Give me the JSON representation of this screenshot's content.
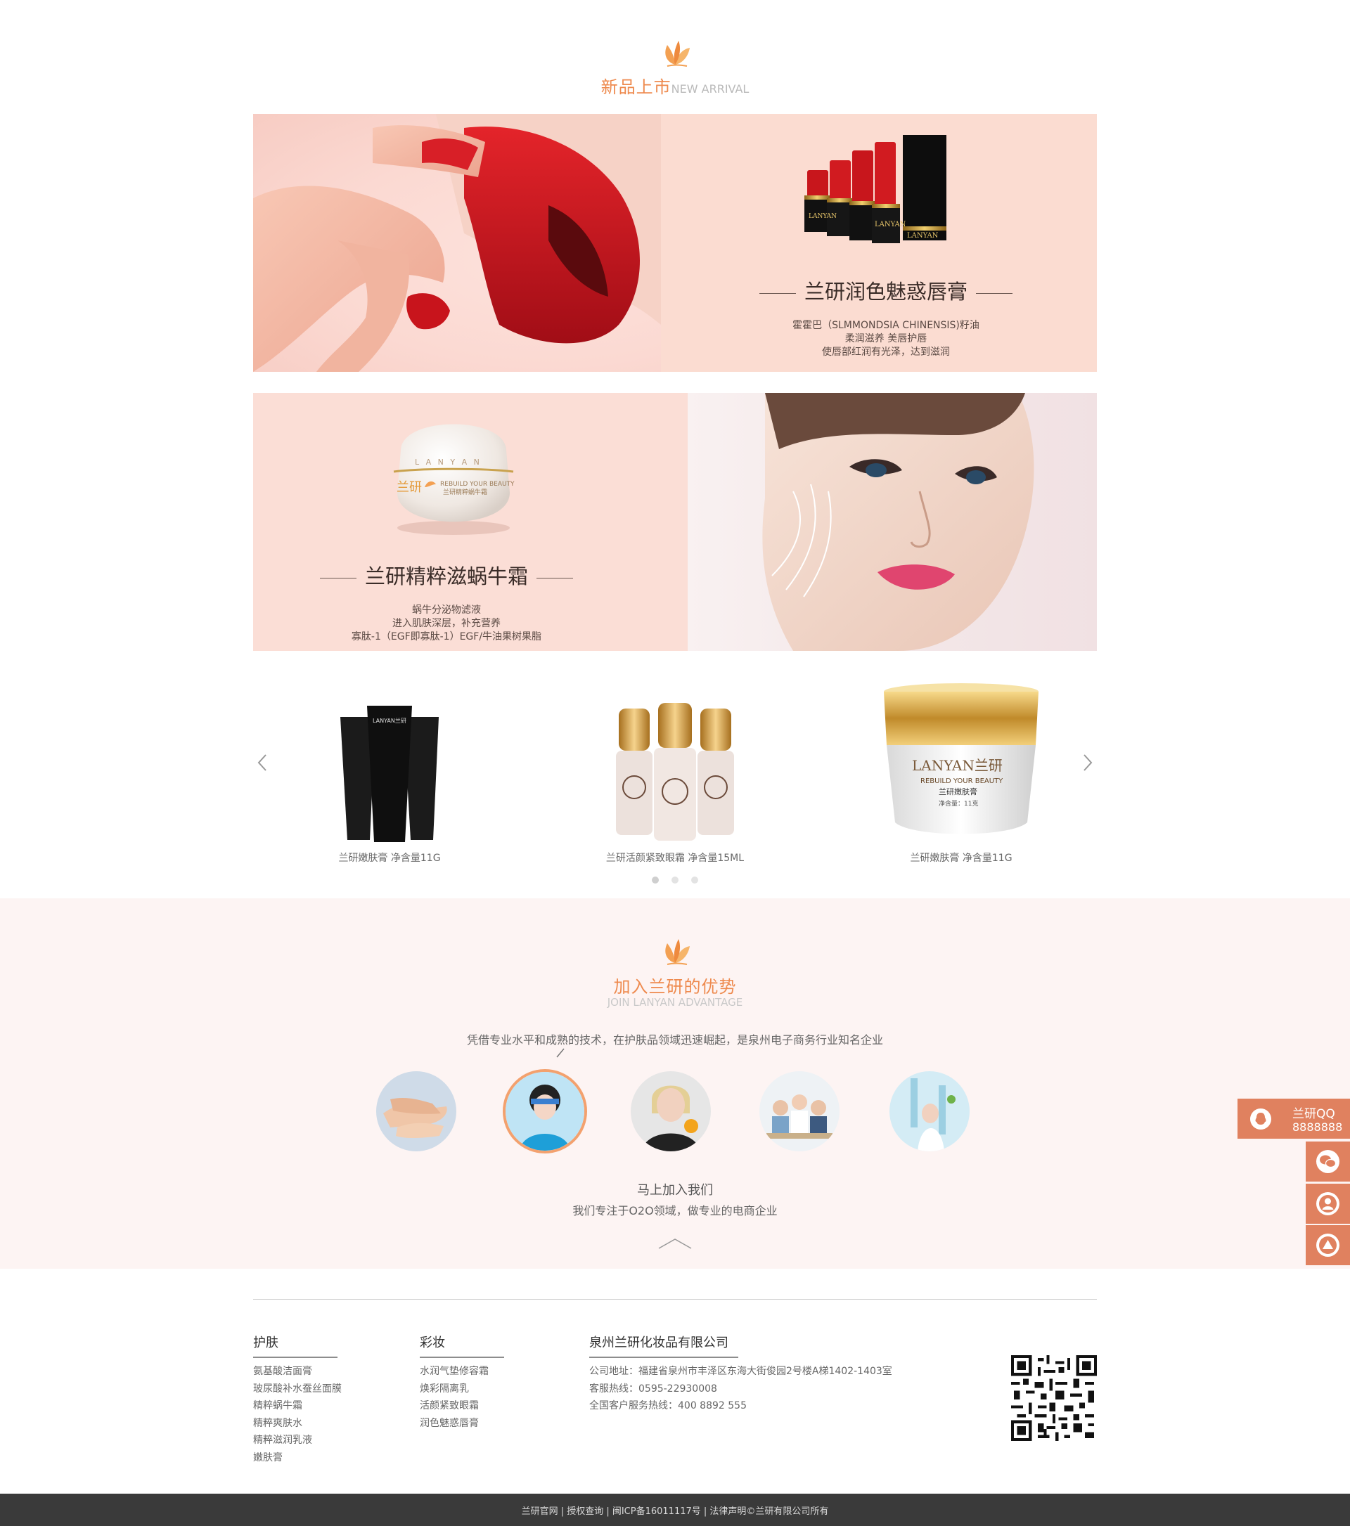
{
  "new_arrival": {
    "title": "新品上市",
    "title_en": "NEW ARRIVAL"
  },
  "banner_lipstick": {
    "name": "兰研润色魅惑唇膏",
    "desc": [
      "霍霍巴（SLMMONDSIA CHINENSIS)籽油",
      "柔润滋养 美唇护唇",
      "使唇部红润有光泽，达到滋润"
    ],
    "product_text": "LANYAN"
  },
  "banner_cream": {
    "name": "兰研精粹滋蜗牛霜",
    "desc": [
      "蜗牛分泌物滤液",
      "进入肌肤深层，补充营养",
      "寡肽-1（EGF即寡肽-1）EGF/牛油果树果脂"
    ],
    "jar_brand": "兰研",
    "jar_tagline": "REBUILD YOUR BEAUTY",
    "jar_name": "兰研精粹蜗牛霜",
    "jar_ring": "L A N Y A N"
  },
  "carousel": {
    "products": [
      {
        "caption": "兰研嫩肤膏  净含量11G"
      },
      {
        "caption": "兰研活颜紧致眼霜  净含量15ML"
      },
      {
        "caption": "兰研嫩肤膏  净含量11G"
      }
    ],
    "tube_label": "LANYAN兰研",
    "jar_label": "LANYAN兰研",
    "jar_tagline": "REBUILD YOUR BEAUTY",
    "jar_name": "兰研嫩肤膏",
    "jar_net": "净含量：11克",
    "active_dot": 0
  },
  "advantage": {
    "title": "加入兰研的优势",
    "title_en": "JOIN LANYAN ADVANTAGE",
    "intro": "凭借专业水平和成熟的技术，在护肤品领域迅速崛起，是泉州电子商务行业知名企业",
    "join_title": "马上加入我们",
    "join_desc": "我们专注于O2O领域，做专业的电商企业",
    "active_circle": 1
  },
  "footer": {
    "skin": {
      "title": "护肤",
      "items": [
        "氨基酸洁面膏",
        "玻尿酸补水蚕丝面膜",
        "精粹蜗牛霜",
        "精粹爽肤水",
        "精粹滋润乳液",
        "嫩肤膏"
      ]
    },
    "makeup": {
      "title": "彩妆",
      "items": [
        "水润气垫修容霜",
        "焕彩隔离乳",
        "活颜紧致眼霜",
        "润色魅惑唇膏"
      ]
    },
    "company": {
      "title": "泉州兰研化妆品有限公司",
      "address": "公司地址：福建省泉州市丰泽区东海大街俊园2号楼A梯1402-1403室",
      "hotline": "客服热线：0595-22930008",
      "national": "全国客户服务热线：400 8892 555"
    },
    "bottom": "兰研官网  |  授权查询  |  闽ICP备16011117号  |  法律声明©兰研有限公司所有"
  },
  "float": {
    "qq_label": "兰研QQ",
    "qq_number": "8888888"
  },
  "colors": {
    "accent": "#ee8a4e",
    "float_bg": "#e0815f",
    "banner_pink": "#fbdcd1",
    "advantage_bg": "#fdf4f3",
    "bottom_bar": "#3a3a3a"
  },
  "icons": [
    "leaf-logo-icon",
    "chevron-left-icon",
    "chevron-right-icon",
    "chevron-up-icon",
    "qq-icon",
    "wechat-icon",
    "user-icon",
    "back-to-top-icon",
    "qr-code-icon"
  ]
}
